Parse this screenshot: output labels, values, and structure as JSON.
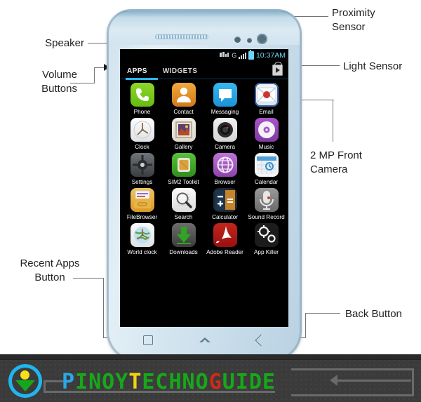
{
  "callouts": {
    "speaker": "Speaker",
    "volume_buttons": "Volume\nButtons",
    "recent_apps_button": "Recent Apps\nButton",
    "proximity_sensor": "Proximity\nSensor",
    "light_sensor": "Light Sensor",
    "front_camera": "2 MP Front\nCamera",
    "back_button": "Back Button"
  },
  "phone": {
    "statusbar": {
      "time": "10:37AM",
      "network_label": "G",
      "icons": [
        "sim-signal-icon",
        "signal-bars-icon",
        "battery-icon"
      ]
    },
    "tabs": [
      {
        "label": "APPS",
        "active": true
      },
      {
        "label": "WIDGETS",
        "active": false
      }
    ],
    "play_store_icon": "play-store-bag-icon",
    "apps": [
      [
        {
          "label": "Phone",
          "icon": "phone-icon"
        },
        {
          "label": "Contact",
          "icon": "contact-icon"
        },
        {
          "label": "Messaging",
          "icon": "messaging-icon"
        },
        {
          "label": "Email",
          "icon": "email-icon"
        }
      ],
      [
        {
          "label": "Clock",
          "icon": "clock-icon"
        },
        {
          "label": "Gallery",
          "icon": "gallery-icon"
        },
        {
          "label": "Camera",
          "icon": "camera-icon"
        },
        {
          "label": "Music",
          "icon": "music-icon"
        }
      ],
      [
        {
          "label": "Settings",
          "icon": "settings-icon"
        },
        {
          "label": "SIM2 Toolkit",
          "icon": "sim-toolkit-icon"
        },
        {
          "label": "Browser",
          "icon": "browser-icon"
        },
        {
          "label": "Calendar",
          "icon": "calendar-icon"
        }
      ],
      [
        {
          "label": "FileBrowser",
          "icon": "file-browser-icon"
        },
        {
          "label": "Search",
          "icon": "search-icon"
        },
        {
          "label": "Calculator",
          "icon": "calculator-icon"
        },
        {
          "label": "Sound Record",
          "icon": "sound-recorder-icon"
        }
      ],
      [
        {
          "label": "World clock",
          "icon": "world-clock-icon"
        },
        {
          "label": "Downloads",
          "icon": "downloads-icon"
        },
        {
          "label": "Adobe Reader",
          "icon": "adobe-reader-icon"
        },
        {
          "label": "App Killer",
          "icon": "app-killer-icon"
        }
      ]
    ],
    "navbar": [
      "recent-apps-nav-icon",
      "home-nav-icon",
      "back-nav-icon"
    ]
  },
  "banner": {
    "brand_segments": [
      {
        "text": "P",
        "color": "#2aa8e8"
      },
      {
        "text": "INOY",
        "color": "#17a818"
      },
      {
        "text": " ",
        "color": "#17a818"
      },
      {
        "text": "T",
        "color": "#f2d017"
      },
      {
        "text": "ECHNO",
        "color": "#17a818"
      },
      {
        "text": " ",
        "color": "#17a818"
      },
      {
        "text": "G",
        "color": "#cf2a18"
      },
      {
        "text": "UIDE",
        "color": "#17a818"
      }
    ],
    "brand_text": "PINOY TECHNO GUIDE",
    "logo": "pinoy-techno-guide-logo"
  },
  "colors": {
    "accent_cyan": "#29b6f0",
    "phone_body": "#cfe2ee",
    "banner_bg": "#3b3b3b",
    "screen_bg": "#000000"
  }
}
